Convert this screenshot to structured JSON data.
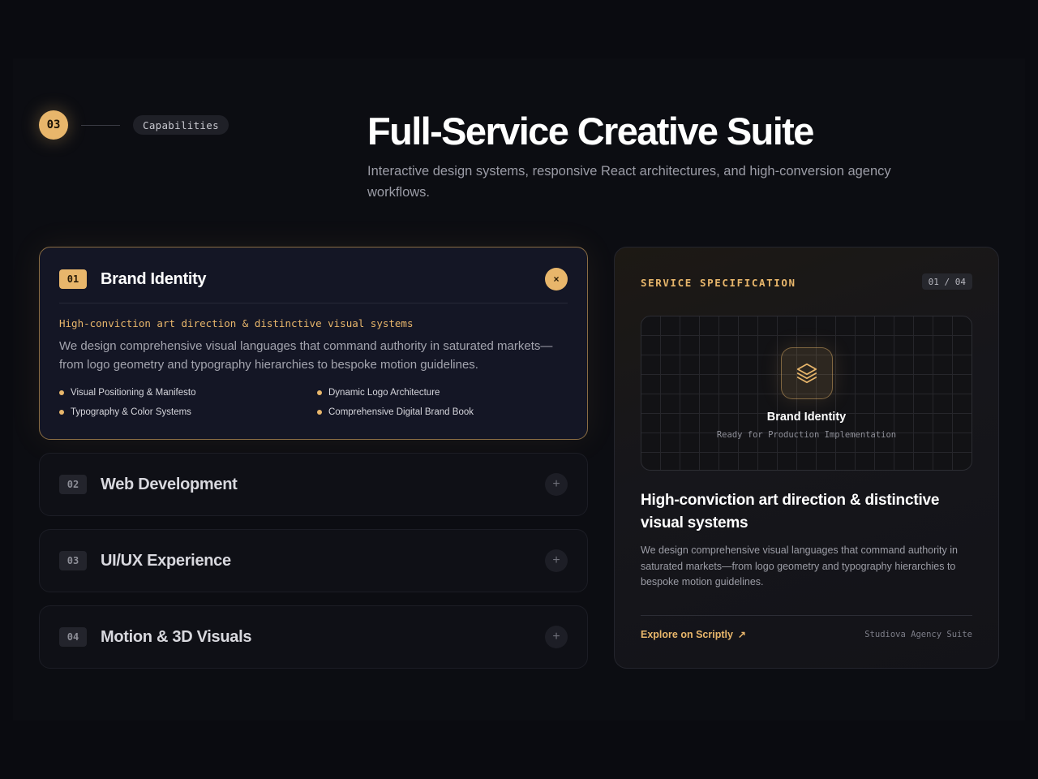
{
  "section": {
    "number": "03",
    "label": "Capabilities"
  },
  "hero": {
    "title": "Full-Service Creative Suite",
    "subtitle": "Interactive design systems, responsive React architectures, and high-conversion agency workflows."
  },
  "services": [
    {
      "num": "01",
      "title": "Brand Identity",
      "expanded": true,
      "toggle": "×",
      "tagline": "High-conviction art direction & distinctive visual systems",
      "description": "We design comprehensive visual languages that command authority in saturated markets—from logo geometry and typography hierarchies to bespoke motion guidelines.",
      "bullets": [
        "Visual Positioning & Manifesto",
        "Dynamic Logo Architecture",
        "Typography & Color Systems",
        "Comprehensive Digital Brand Book"
      ]
    },
    {
      "num": "02",
      "title": "Web Development",
      "expanded": false,
      "toggle": "+"
    },
    {
      "num": "03",
      "title": "UI/UX Experience",
      "expanded": false,
      "toggle": "+"
    },
    {
      "num": "04",
      "title": "Motion & 3D Visuals",
      "expanded": false,
      "toggle": "+"
    }
  ],
  "spec": {
    "label": "SERVICE SPECIFICATION",
    "counter": "01 / 04",
    "icon": "layers-icon",
    "preview_title": "Brand Identity",
    "preview_subtitle": "Ready for Production Implementation",
    "heading": "High-conviction art direction & distinctive visual systems",
    "description": "We design comprehensive visual languages that command authority in saturated markets—from logo geometry and typography hierarchies to bespoke motion guidelines.",
    "link_label": "Explore on Scriptly",
    "link_arrow": "↗",
    "footer": "Studiova Agency Suite"
  },
  "colors": {
    "accent": "#e8b66b",
    "background": "#0a0b10",
    "card": "#141625"
  }
}
